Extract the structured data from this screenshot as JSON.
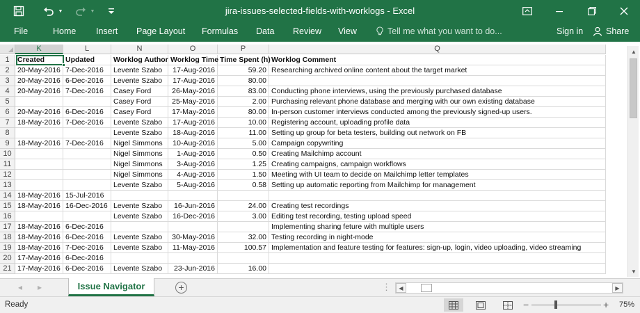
{
  "window": {
    "title": "jira-issues-selected-fields-with-worklogs - Excel"
  },
  "ribbon": {
    "tabs": [
      "File",
      "Home",
      "Insert",
      "Page Layout",
      "Formulas",
      "Data",
      "Review",
      "View"
    ],
    "tell_me": "Tell me what you want to do...",
    "sign_in": "Sign in",
    "share": "Share"
  },
  "sheet": {
    "columns": [
      "K",
      "L",
      "N",
      "O",
      "P",
      "Q"
    ],
    "selected_column": "K",
    "selected_cell": "K1",
    "row_numbers": [
      "1",
      "2",
      "3",
      "4",
      "5",
      "6",
      "7",
      "8",
      "9",
      "10",
      "11",
      "12",
      "13",
      "14",
      "15",
      "16",
      "17",
      "18",
      "19",
      "20",
      "21"
    ],
    "header": [
      "Created",
      "Updated",
      "Worklog Author",
      "Worklog Time",
      "Time Spent (h)",
      "Worklog Comment"
    ],
    "rows": [
      [
        "20-May-2016",
        "7-Dec-2016",
        "Levente Szabo",
        "17-Aug-2016",
        "59.20",
        "Researching archived online content about the target market"
      ],
      [
        "20-May-2016",
        "6-Dec-2016",
        "Levente Szabo",
        "17-Aug-2016",
        "80.00",
        ""
      ],
      [
        "20-May-2016",
        "7-Dec-2016",
        "Casey Ford",
        "26-May-2016",
        "83.00",
        "Conducting phone interviews, using the previously purchased database"
      ],
      [
        "",
        "",
        "Casey Ford",
        "25-May-2016",
        "2.00",
        "Purchasing relevant phone database and merging with our own existing database"
      ],
      [
        "20-May-2016",
        "6-Dec-2016",
        "Casey Ford",
        "17-May-2016",
        "80.00",
        "In-person customer interviews conducted among the previously signed-up users."
      ],
      [
        "18-May-2016",
        "7-Dec-2016",
        "Levente Szabo",
        "17-Aug-2016",
        "10.00",
        "Registering account, uploading profile data"
      ],
      [
        "",
        "",
        "Levente Szabo",
        "18-Aug-2016",
        "11.00",
        "Setting up group for beta testers, building out network on FB"
      ],
      [
        "18-May-2016",
        "7-Dec-2016",
        "Nigel Simmons",
        "10-Aug-2016",
        "5.00",
        "Campaign copywriting"
      ],
      [
        "",
        "",
        "Nigel Simmons",
        "1-Aug-2016",
        "0.50",
        "Creating Mailchimp account"
      ],
      [
        "",
        "",
        "Nigel Simmons",
        "3-Aug-2016",
        "1.25",
        "Creating campaigns, campaign workflows"
      ],
      [
        "",
        "",
        "Nigel Simmons",
        "4-Aug-2016",
        "1.50",
        "Meeting with UI team to decide on Mailchimp letter templates"
      ],
      [
        "",
        "",
        "Levente Szabo",
        "5-Aug-2016",
        "0.58",
        "Setting up automatic reporting from Mailchimp for management"
      ],
      [
        "18-May-2016",
        "15-Jul-2016",
        "",
        "",
        "",
        ""
      ],
      [
        "18-May-2016",
        "16-Dec-2016",
        "Levente Szabo",
        "16-Jun-2016",
        "24.00",
        "Creating test recordings"
      ],
      [
        "",
        "",
        "Levente Szabo",
        "16-Dec-2016",
        "3.00",
        "Editing test recording, testing upload speed"
      ],
      [
        "18-May-2016",
        "6-Dec-2016",
        "",
        "",
        "",
        "Implementing sharing feture with multiple users"
      ],
      [
        "18-May-2016",
        "6-Dec-2016",
        "Levente Szabo",
        "30-May-2016",
        "32.00",
        "Testing recording in night-mode"
      ],
      [
        "18-May-2016",
        "7-Dec-2016",
        "Levente Szabo",
        "11-May-2016",
        "100.57",
        "Implementation and feature testing for features: sign-up, login, video uploading, video streaming"
      ],
      [
        "17-May-2016",
        "6-Dec-2016",
        "",
        "",
        "",
        ""
      ],
      [
        "17-May-2016",
        "6-Dec-2016",
        "Levente Szabo",
        "23-Jun-2016",
        "16.00",
        ""
      ]
    ]
  },
  "sheet_tabs": {
    "active": "Issue Navigator"
  },
  "status": {
    "text": "Ready",
    "zoom": "75%"
  }
}
